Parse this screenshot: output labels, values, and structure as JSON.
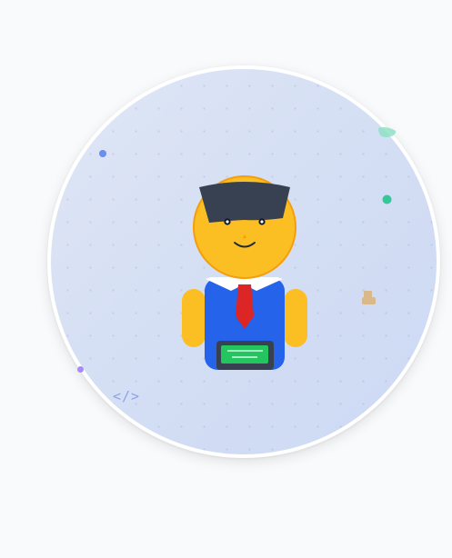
{
  "avatar": {
    "code_symbol": "</>"
  },
  "colors": {
    "background": "#f9fafb",
    "disc_gradient_start": "#dfe6f5",
    "disc_gradient_end": "#cdd9f5",
    "skin": "#fbbf24",
    "skin_outline": "#f59e0b",
    "hat": "#374151",
    "shirt": "#2563eb",
    "tie": "#dc2626",
    "collar": "#ffffff",
    "badge_frame": "#374151",
    "badge_screen": "#22c55e",
    "dot_blue": "#6b8ef0",
    "dot_green": "#34c79a",
    "dot_purple": "#a78bfa",
    "code_symbol": "#8ea2e6",
    "coffee_cup": "#d9b98a"
  },
  "icons": {
    "character": "developer-avatar",
    "cup": "coffee-cup-icon",
    "code": "code-brackets-icon"
  }
}
